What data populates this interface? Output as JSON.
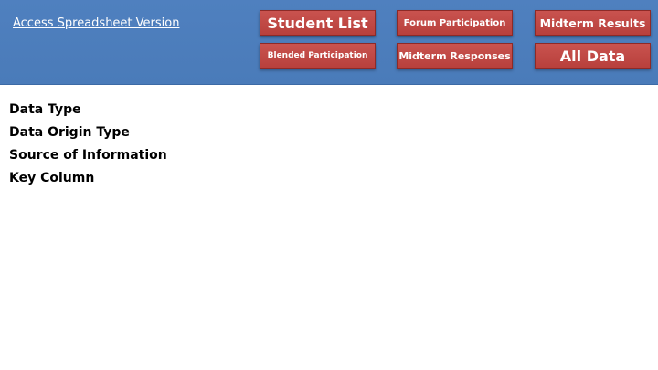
{
  "header": {
    "link_label": "Access Spreadsheet Version",
    "background_color": "#4f80bf",
    "buttons": {
      "student_list": "Student List",
      "forum_participation": "Forum Participation",
      "midterm_results": "Midterm Results",
      "blended_participation": "Blended Participation",
      "midterm_responses": "Midterm Responses",
      "all_data": "All Data"
    },
    "button_color": "#c04a46"
  },
  "main": {
    "fields": [
      "Data Type",
      "Data Origin Type",
      "Source of Information",
      "Key Column"
    ]
  }
}
